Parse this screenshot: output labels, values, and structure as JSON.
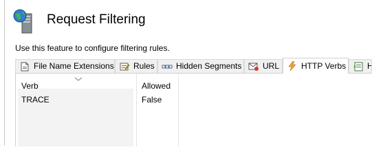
{
  "page": {
    "title": "Request Filtering",
    "description": "Use this feature to configure filtering rules.",
    "icon": "server-globe-icon"
  },
  "tabs": [
    {
      "label": "File Name Extensions",
      "icon": "file-extension-icon"
    },
    {
      "label": "Rules",
      "icon": "rules-icon"
    },
    {
      "label": "Hidden Segments",
      "icon": "hidden-segments-icon"
    },
    {
      "label": "URL",
      "icon": "url-icon"
    },
    {
      "label": "HTTP Verbs",
      "icon": "http-verbs-icon",
      "active": true
    },
    {
      "label": "H",
      "icon": "headers-icon"
    }
  ],
  "grid": {
    "columns": [
      "Verb",
      "Allowed"
    ],
    "rows": [
      {
        "verb": "TRACE",
        "allowed": "False"
      }
    ]
  }
}
